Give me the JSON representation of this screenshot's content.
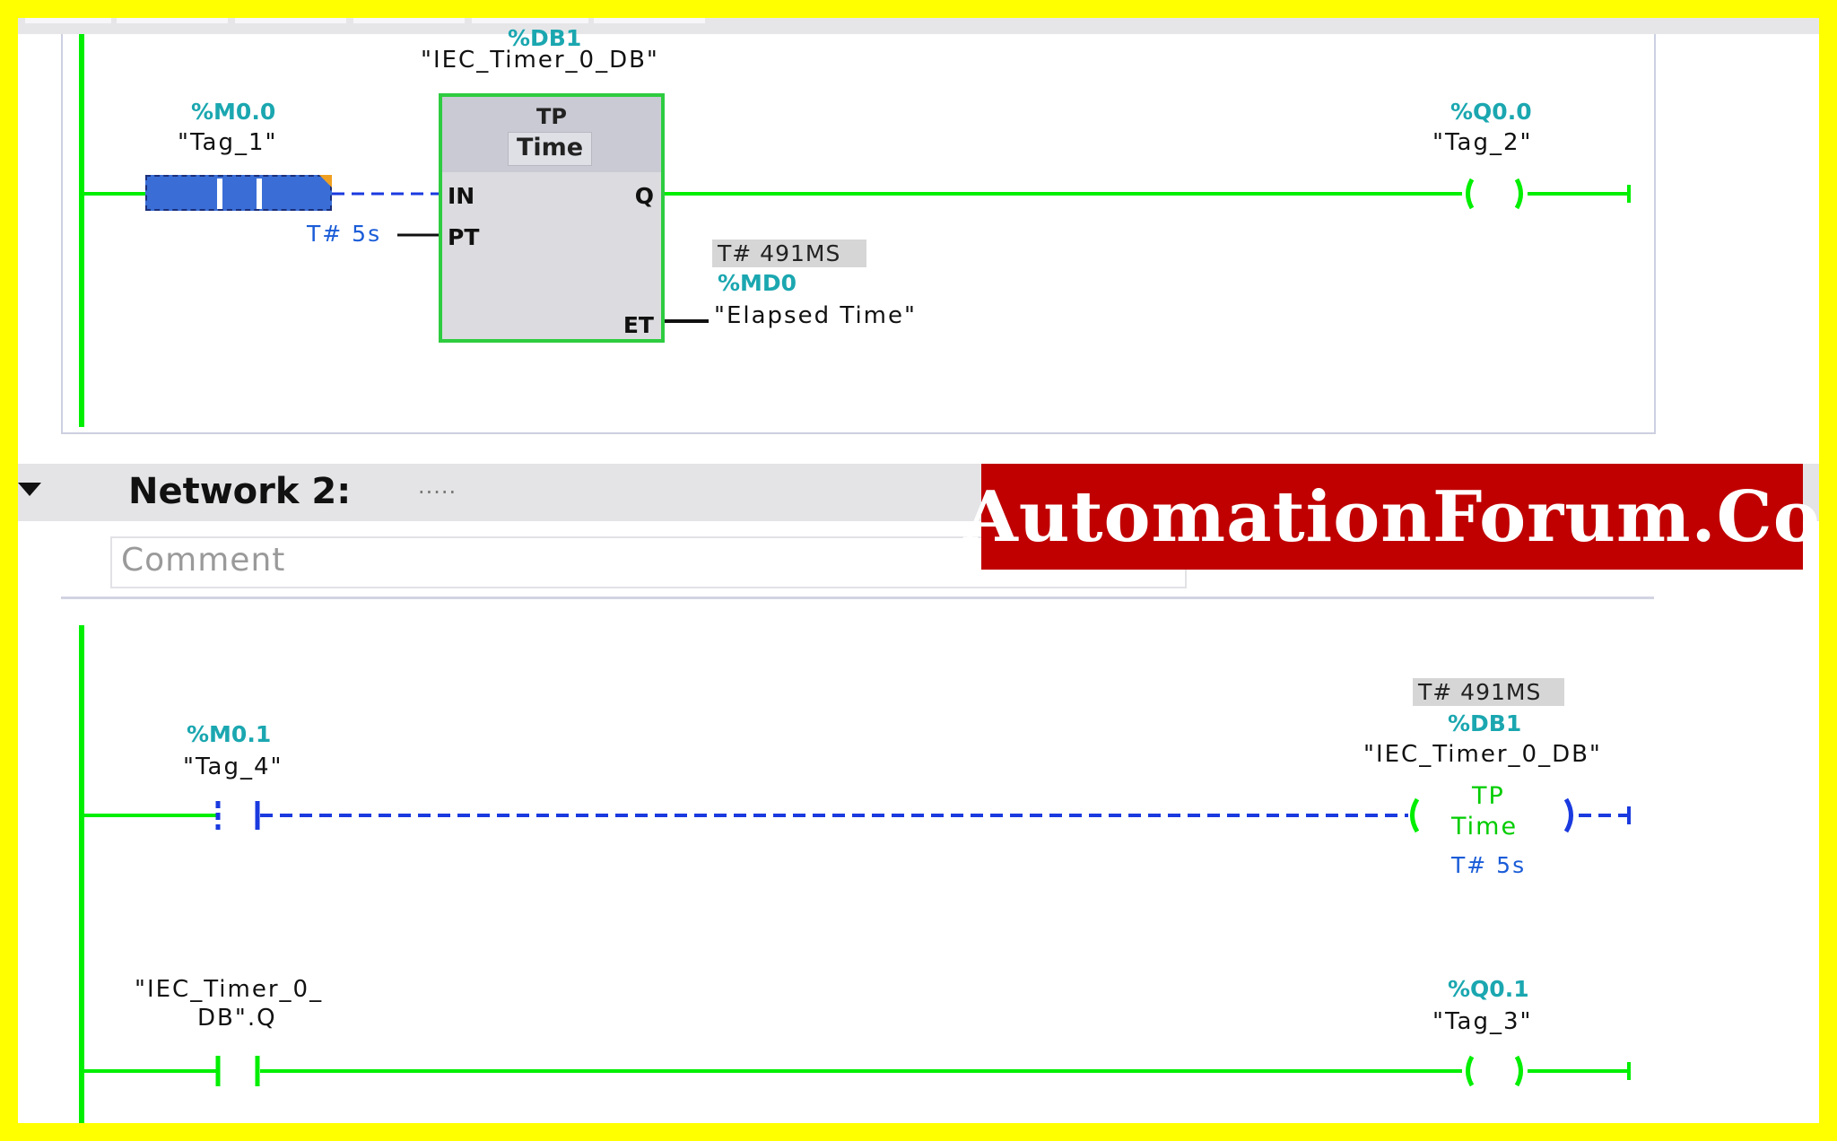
{
  "network1": {
    "timer_db_address": "%DB1",
    "timer_db_symbol": "\"IEC_Timer_0_DB\"",
    "input_address": "%M0.0",
    "input_symbol": "\"Tag_1\"",
    "timer_block": {
      "name": "TP",
      "type": "Time",
      "pin_in": "IN",
      "pin_q": "Q",
      "pin_pt": "PT",
      "pin_et": "ET"
    },
    "preset_value": "T# 5s",
    "elapsed_value": "T# 491MS",
    "elapsed_address": "%MD0",
    "elapsed_symbol": "\"Elapsed Time\"",
    "output_address": "%Q0.0",
    "output_symbol": "\"Tag_2\""
  },
  "network2": {
    "title": "Network 2:",
    "title_placeholder": ".....",
    "comment_placeholder": "Comment",
    "rung1": {
      "input_address": "%M0.1",
      "input_symbol": "\"Tag_4\"",
      "coil_value": "T# 491MS",
      "coil_db_address": "%DB1",
      "coil_db_symbol": "\"IEC_Timer_0_DB\"",
      "coil_name": "TP",
      "coil_type": "Time",
      "coil_preset": "T# 5s"
    },
    "rung2": {
      "input_symbol_line1": "\"IEC_Timer_0_",
      "input_symbol_line2": "DB\".Q",
      "output_address": "%Q0.1",
      "output_symbol": "\"Tag_3\""
    }
  },
  "watermark": "AutomationForum.Co",
  "colors": {
    "frame": "#ffff00",
    "energized_wire": "#00ee00",
    "unenergized_wire": "#1a3adf",
    "address_text": "#1ba7b0",
    "banner": "#c00000"
  }
}
